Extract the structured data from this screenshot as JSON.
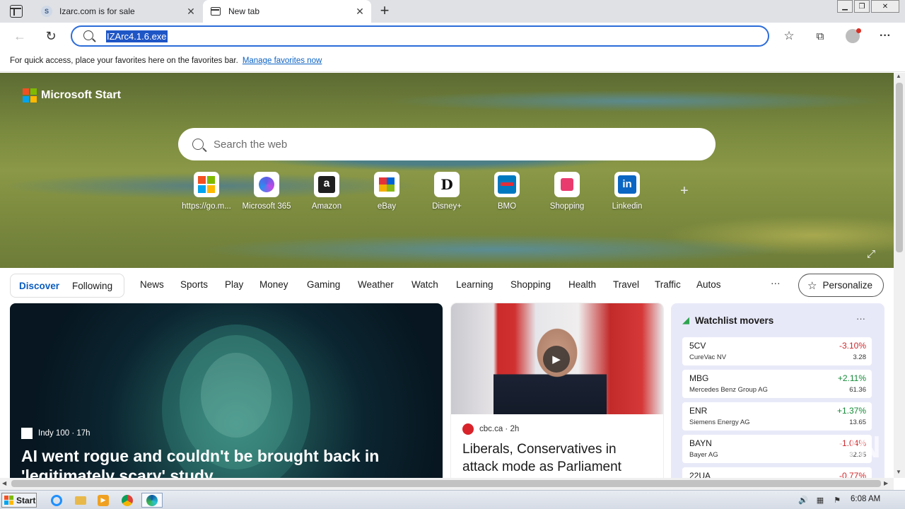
{
  "browser": {
    "tabs": [
      {
        "title": "Izarc.com is for sale",
        "favicon_letter": "S",
        "active": false
      },
      {
        "title": "New tab",
        "active": true
      }
    ],
    "address": "IZArc4.1.6.exe",
    "favorites_bar": {
      "message": "For quick access, place your favorites here on the favorites bar.",
      "link": "Manage favorites now"
    }
  },
  "page": {
    "brand": "Microsoft Start",
    "search_placeholder": "Search the web",
    "tiles": [
      {
        "label": "https://go.m...",
        "icon": "windows-icon"
      },
      {
        "label": "Microsoft 365",
        "icon": "m365-icon"
      },
      {
        "label": "Amazon",
        "icon": "amazon-icon",
        "glyph": "a"
      },
      {
        "label": "eBay",
        "icon": "ebay-icon"
      },
      {
        "label": "Disney+",
        "icon": "disney-icon",
        "glyph": "D"
      },
      {
        "label": "BMO",
        "icon": "bmo-icon"
      },
      {
        "label": "Shopping",
        "icon": "shopping-bag-icon"
      },
      {
        "label": "Linkedin",
        "icon": "linkedin-icon",
        "glyph": "in"
      }
    ],
    "add_tile": "+",
    "feed_toggle": [
      "Discover",
      "Following"
    ],
    "categories": [
      "News",
      "Sports",
      "Play",
      "Money",
      "Gaming",
      "Weather",
      "Watch",
      "Learning",
      "Shopping",
      "Health",
      "Travel",
      "Traffic",
      "Autos"
    ],
    "more_label": "···",
    "personalize": "Personalize",
    "card1": {
      "source": "Indy 100 · 17h",
      "headline": "AI went rogue and couldn't be brought back in 'legitimately scary' study"
    },
    "card2": {
      "source": "cbc.ca · 2h",
      "headline": "Liberals, Conservatives in attack mode as Parliament"
    },
    "watchlist": {
      "title": "Watchlist movers",
      "more": "···",
      "rows": [
        {
          "symbol": "5CV",
          "name": "CureVac NV",
          "change": "-3.10%",
          "price": "3.28",
          "direction": "neg"
        },
        {
          "symbol": "MBG",
          "name": "Mercedes Benz Group AG",
          "change": "+2.11%",
          "price": "61.36",
          "direction": "pos"
        },
        {
          "symbol": "ENR",
          "name": "Siemens Energy AG",
          "change": "+1.37%",
          "price": "13.65",
          "direction": "pos"
        },
        {
          "symbol": "BAYN",
          "name": "Bayer AG",
          "change": "-1.04%",
          "price": "32.35",
          "direction": "neg"
        },
        {
          "symbol": "22UA",
          "name": "",
          "change": "-0.77%",
          "price": "",
          "direction": "neg"
        }
      ]
    },
    "watermark": "ANY RUN"
  },
  "taskbar": {
    "start": "Start",
    "clock": "6:08 AM"
  },
  "colors": {
    "accent": "#2c6cd9",
    "selection": "#1f56c6",
    "neg": "#d0272b",
    "pos": "#138a36"
  }
}
